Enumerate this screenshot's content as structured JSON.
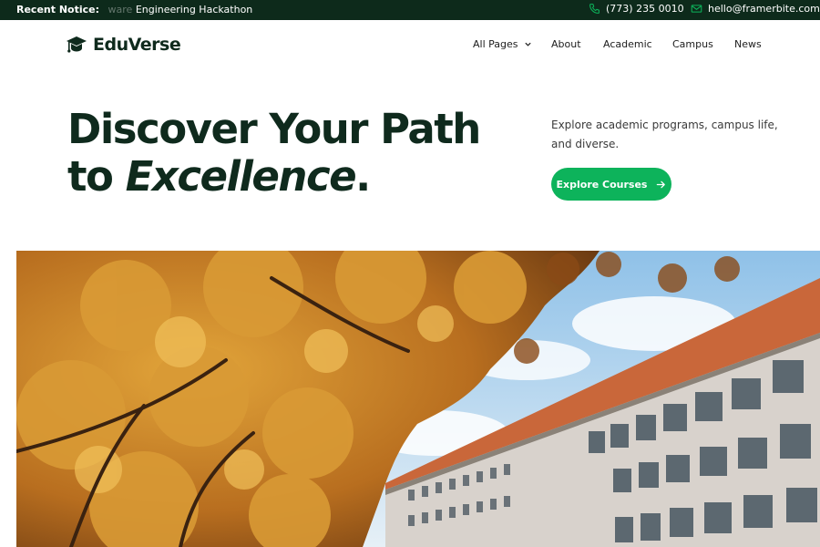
{
  "notice": {
    "label": "Recent Notice:",
    "faded": "ware",
    "text": "Engineering Hackathon"
  },
  "contact": {
    "phone": "(773) 235 0010",
    "email": "hello@framerbite.com"
  },
  "brand": {
    "name": "EduVerse"
  },
  "nav": {
    "all_pages": "All Pages",
    "about": "About",
    "academic": "Academic",
    "campus": "Campus",
    "news": "News"
  },
  "hero": {
    "title_line1": "Discover Your Path",
    "title_line2_prefix": "to ",
    "title_line2_em": "Excellence",
    "title_line2_suffix": ".",
    "description": "Explore academic programs, campus life, and diverse.",
    "cta_label": "Explore Courses"
  },
  "colors": {
    "topbar_bg": "#0d2a1b",
    "brand_dark": "#0f2a1d",
    "accent_green": "#0db35b"
  },
  "icons": {
    "phone": "phone-icon",
    "email": "mail-icon",
    "logo": "graduation-cap-icon",
    "dropdown": "chevron-down-icon",
    "cta": "arrow-right-icon"
  }
}
